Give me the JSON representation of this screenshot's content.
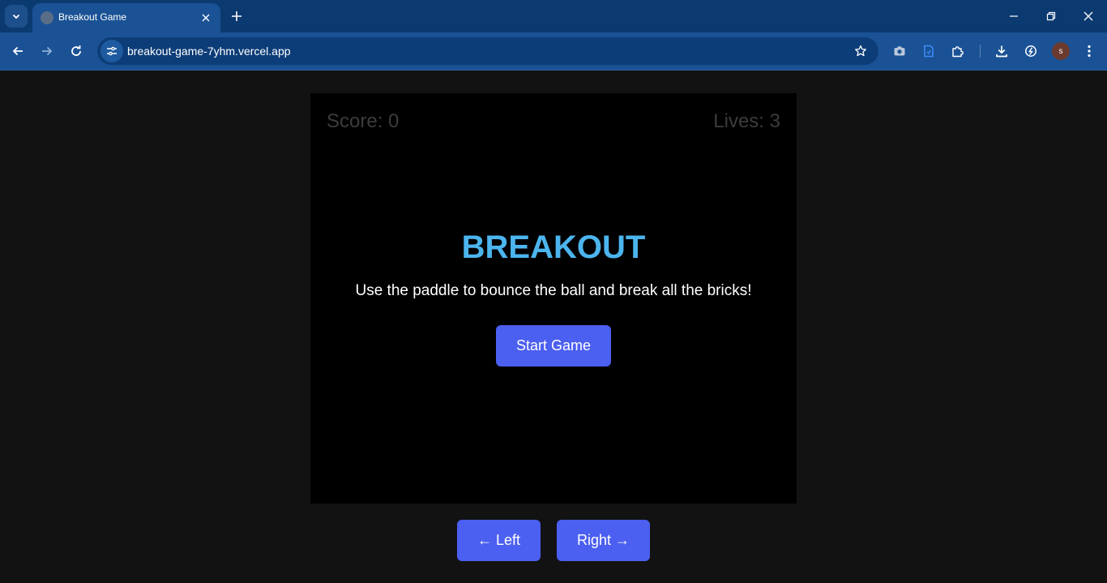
{
  "browser": {
    "tab_title": "Breakout Game",
    "url": "breakout-game-7yhm.vercel.app",
    "profile_initial": "s",
    "accent": "#1a5295"
  },
  "game": {
    "score_text": "Score: 0",
    "lives_text": "Lives: 3",
    "title": "BREAKOUT",
    "instructions": "Use the paddle to bounce the ball and break all the bricks!",
    "start_label": "Start Game",
    "title_color": "#4cb5ee",
    "button_color": "#4b5ff0"
  },
  "controls": {
    "left_label": "← Left",
    "right_label": "Right →"
  }
}
